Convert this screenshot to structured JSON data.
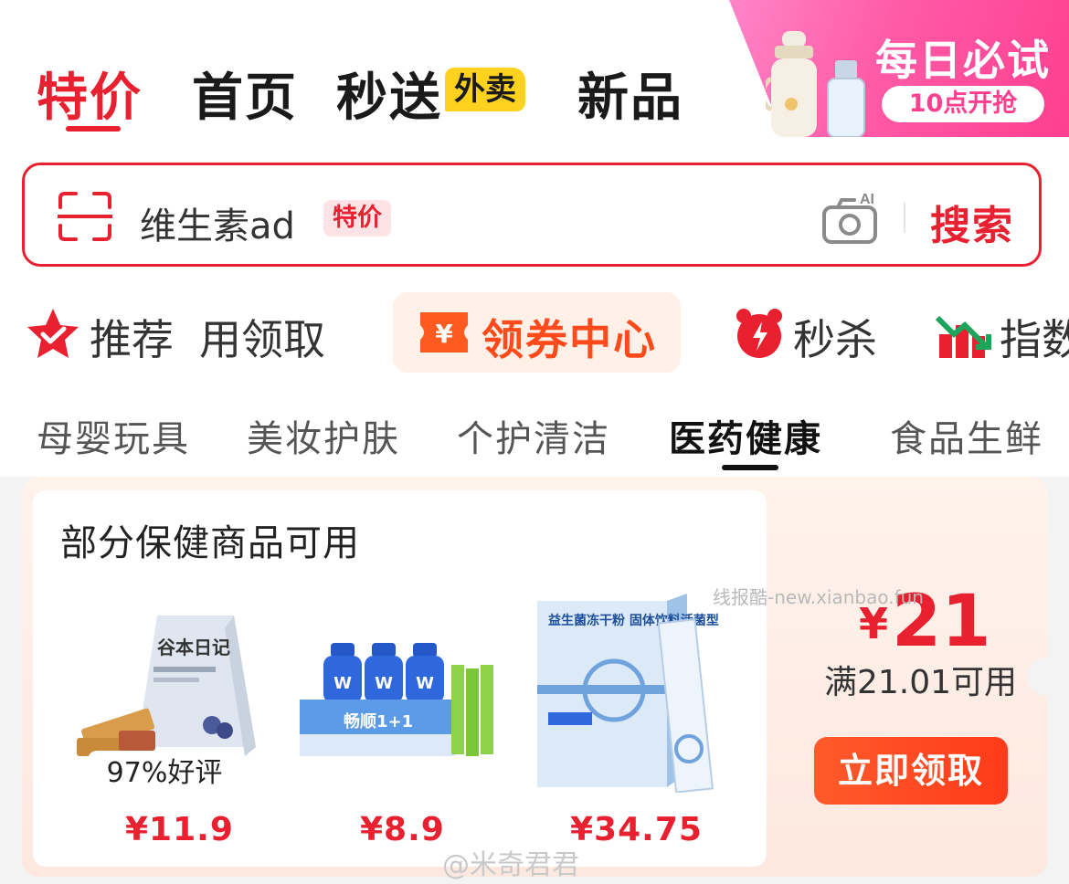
{
  "top_tabs": [
    {
      "label": "特价",
      "active": true
    },
    {
      "label": "首页",
      "active": false
    },
    {
      "label": "秒送",
      "active": false,
      "badge": "外卖"
    },
    {
      "label": "新品",
      "active": false
    }
  ],
  "promo": {
    "title": "每日必试",
    "subtitle": "10点开抢"
  },
  "search": {
    "query": "维生素ad",
    "tag": "特价",
    "camera_badge": "AI",
    "button": "搜索"
  },
  "channels": [
    {
      "label": "推荐",
      "icon": "star-check-icon"
    },
    {
      "label": "用领取",
      "icon": ""
    },
    {
      "label": "领券中心",
      "icon": "yen-ticket-icon",
      "highlight": true
    },
    {
      "label": "秒杀",
      "icon": "alarm-clock-icon"
    },
    {
      "label": "指数",
      "icon": "chart-icon"
    }
  ],
  "categories": [
    {
      "label": "母婴玩具",
      "active": false
    },
    {
      "label": "美妆护肤",
      "active": false
    },
    {
      "label": "个护清洁",
      "active": false
    },
    {
      "label": "医药健康",
      "active": true
    },
    {
      "label": "食品生鲜",
      "active": false
    }
  ],
  "coupon": {
    "title": "部分保健商品可用",
    "currency": "¥",
    "amount": "21",
    "condition": "满21.01可用",
    "claim_button": "立即领取",
    "products": [
      {
        "name_on_pack": "谷本日记",
        "rating": "97%好评",
        "price": "¥11.9"
      },
      {
        "name_on_pack": "畅顺1+1",
        "rating": "",
        "price": "¥8.9"
      },
      {
        "name_on_pack": "益生菌冻干粉 固体饮料活菌型",
        "rating": "",
        "price": "¥34.75"
      }
    ]
  },
  "watermarks": {
    "site": "线报酷-new.xianbao.fun",
    "weibo": "@米奇君君"
  },
  "colors": {
    "brand_red": "#e8202f",
    "coupon_orange": "#ff4a1c",
    "waimai_yellow": "#ffd21f",
    "promo_pink": "#ff5aa6"
  }
}
